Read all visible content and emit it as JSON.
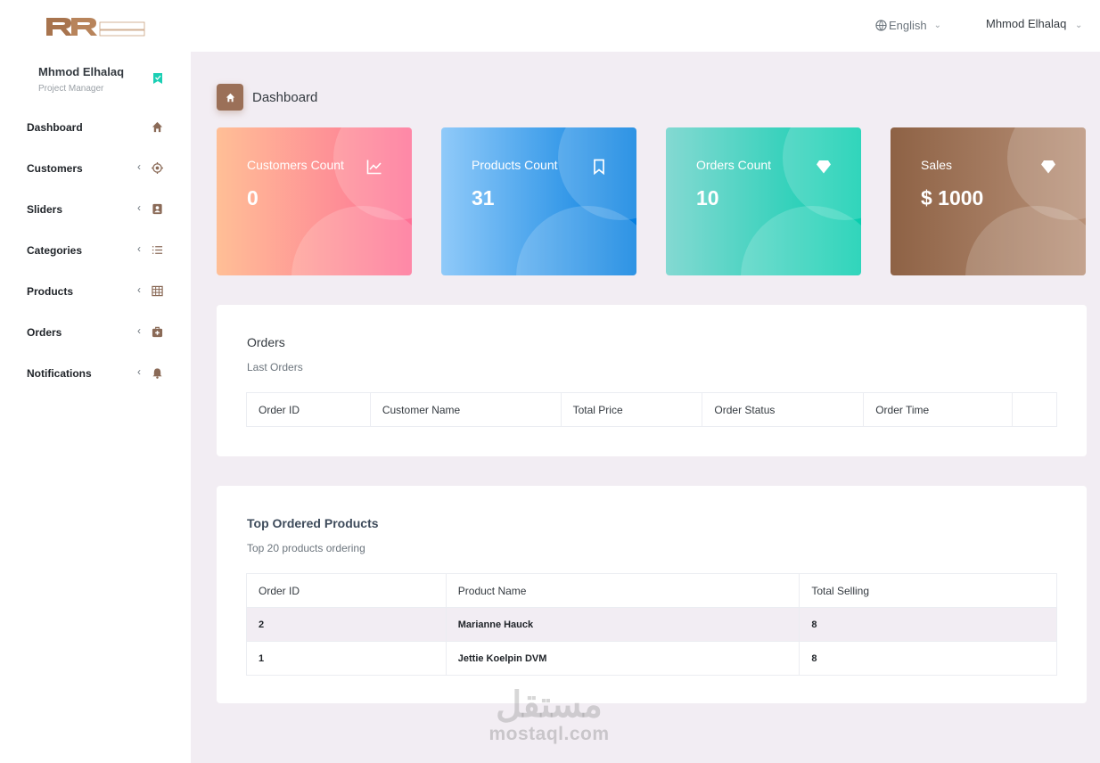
{
  "header": {
    "language": "English",
    "user_name": "Mhmod Elhalaq"
  },
  "sidebar": {
    "profile": {
      "name": "Mhmod Elhalaq",
      "role": "Project Manager"
    },
    "items": [
      {
        "label": "Dashboard",
        "icon": "home-icon",
        "has_caret": false
      },
      {
        "label": "Customers",
        "icon": "crosshair-icon",
        "has_caret": true
      },
      {
        "label": "Sliders",
        "icon": "contact-card-icon",
        "has_caret": true
      },
      {
        "label": "Categories",
        "icon": "list-icon",
        "has_caret": true
      },
      {
        "label": "Products",
        "icon": "grid-icon",
        "has_caret": true
      },
      {
        "label": "Orders",
        "icon": "medical-bag-icon",
        "has_caret": true
      },
      {
        "label": "Notifications",
        "icon": "bell-icon",
        "has_caret": true
      }
    ]
  },
  "page": {
    "title": "Dashboard"
  },
  "stats": [
    {
      "title": "Customers Count",
      "value": "0",
      "icon": "chart-line-icon",
      "gradient": [
        "#ffbf96",
        "#fe7096"
      ]
    },
    {
      "title": "Products Count",
      "value": "31",
      "icon": "bookmark-icon",
      "gradient": [
        "#90caf9",
        "#047edf"
      ]
    },
    {
      "title": "Orders Count",
      "value": "10",
      "icon": "diamond-icon",
      "gradient": [
        "#84d9d2",
        "#07cdae"
      ]
    },
    {
      "title": "Sales",
      "value": "$ 1000",
      "icon": "diamond-icon",
      "gradient": [
        "#8e6245",
        "#b89178"
      ]
    }
  ],
  "orders_panel": {
    "title": "Orders",
    "subtitle": "Last Orders",
    "columns": [
      "Order ID",
      "Customer Name",
      "Total Price",
      "Order Status",
      "Order Time",
      ""
    ]
  },
  "top_products_panel": {
    "title": "Top Ordered Products",
    "subtitle": "Top 20 products ordering",
    "columns": [
      "Order ID",
      "Product Name",
      "Total Selling"
    ],
    "rows": [
      [
        "2",
        "Marianne Hauck",
        "8"
      ],
      [
        "1",
        "Jettie Koelpin DVM",
        "8"
      ]
    ]
  },
  "watermark": {
    "arabic": "مستقل",
    "latin": "mostaql.com"
  },
  "colors": {
    "accent": "#9b7058",
    "background": "#f2edf3",
    "badge": "#1bcfb4"
  }
}
